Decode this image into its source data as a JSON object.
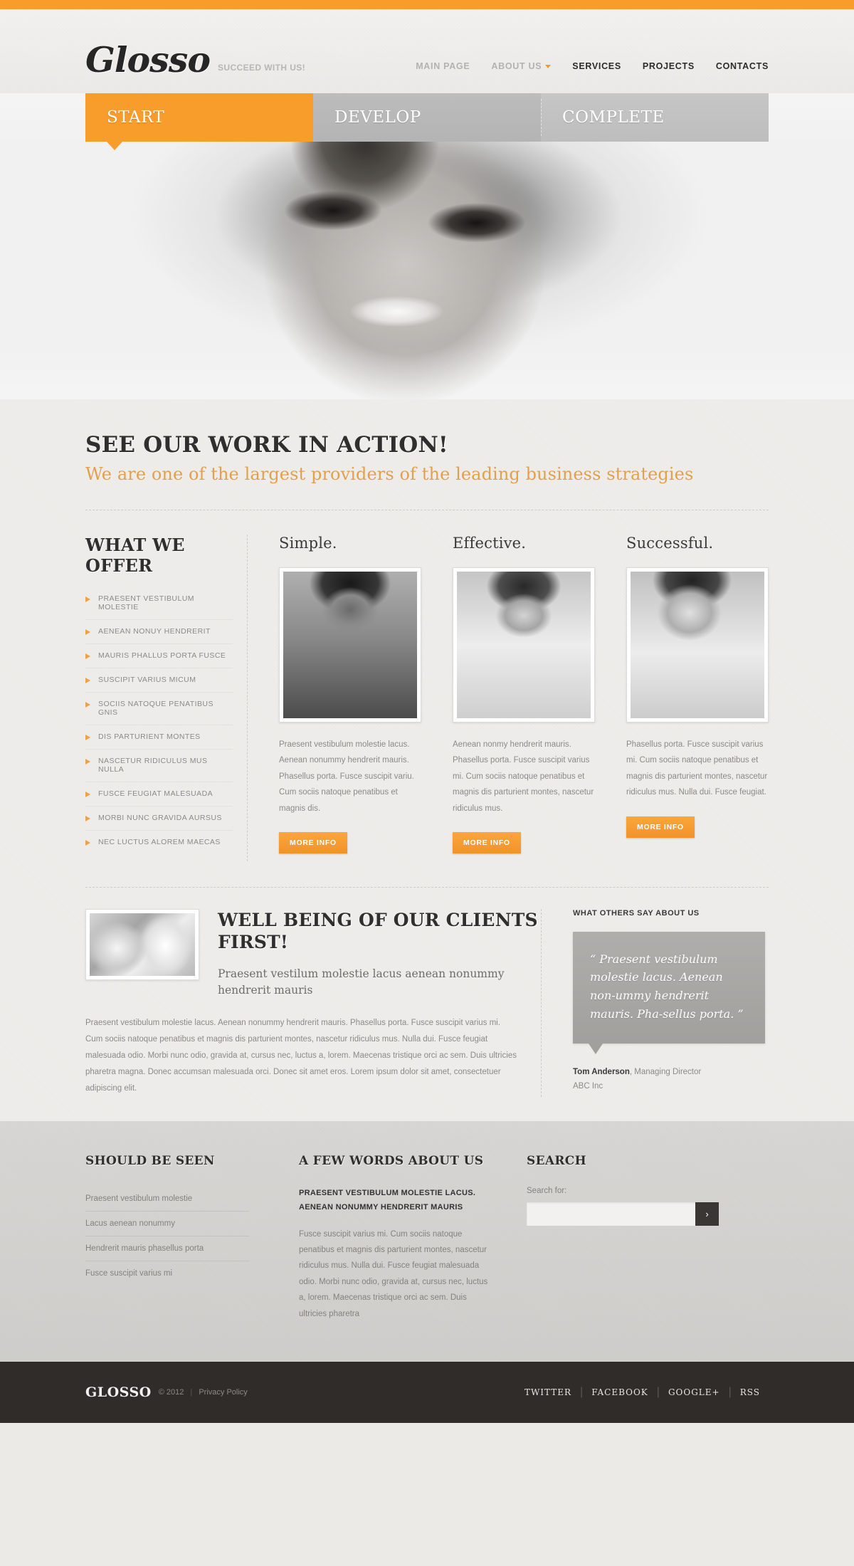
{
  "brand": {
    "logo": "Glosso",
    "tagline": "SUCCEED WITH US!"
  },
  "nav": {
    "items": [
      {
        "label": "MAIN PAGE",
        "state": "dim",
        "caret": false
      },
      {
        "label": "ABOUT US",
        "state": "dim",
        "caret": true
      },
      {
        "label": "SERVICES",
        "state": "active",
        "caret": false
      },
      {
        "label": "PROJECTS",
        "state": "active",
        "caret": false
      },
      {
        "label": "CONTACTS",
        "state": "active",
        "caret": false
      }
    ]
  },
  "tabs": [
    {
      "label": "START",
      "active": true
    },
    {
      "label": "DEVELOP",
      "active": false
    },
    {
      "label": "COMPLETE",
      "active": false
    }
  ],
  "intro": {
    "title": "SEE OUR WORK IN ACTION!",
    "subtitle": "We are one of the largest providers of the leading business strategies"
  },
  "offer": {
    "heading": "WHAT WE OFFER",
    "items": [
      "PRAESENT VESTIBULUM MOLESTIE",
      "AENEAN NONUY HENDRERIT",
      "MAURIS PHALLUS PORTA FUSCE",
      "SUSCIPIT VARIUS MICUM",
      "SOCIIS NATOQUE PENATIBUS GNIS",
      "DIS PARTURIENT MONTES",
      "NASCETUR RIDICULUS MUS NULLA",
      "FUSCE FEUGIAT MALESUADA",
      "MORBI NUNC GRAVIDA AURSUS",
      "NEC LUCTUS ALOREM  MAECAS"
    ]
  },
  "cards": [
    {
      "title": "Simple.",
      "text": "Praesent vestibulum molestie lacus. Aenean nonummy hendrerit mauris. Phasellus porta. Fusce suscipit variu. Cum sociis natoque penatibus et magnis dis.",
      "button": "MORE INFO",
      "image": "portrait-man-dark"
    },
    {
      "title": "Effective.",
      "text": "Aenean nonmy hendrerit mauris. Phasellus porta. Fusce suscipit varius mi. Cum sociis natoque penatibus et magnis dis parturient montes, nascetur ridiculus mus.",
      "button": "MORE INFO",
      "image": "portrait-man-glasses"
    },
    {
      "title": "Successful.",
      "text": "Phasellus porta. Fusce suscipit varius mi. Cum sociis natoque penatibus et magnis dis parturient montes, nascetur ridiculus mus. Nulla dui. Fusce feugiat.",
      "button": "MORE INFO",
      "image": "portrait-woman-phone"
    }
  ],
  "wellbeing": {
    "heading": "WELL BEING OF OUR CLIENTS FIRST!",
    "lead": "Praesent vestilum molestie lacus aenean nonummy hendrerit mauris",
    "body": "Praesent vestibulum molestie lacus. Aenean nonummy hendrerit mauris. Phasellus porta. Fusce suscipit varius mi. Cum sociis natoque penatibus et magnis dis parturient montes, nascetur ridiculus mus. Nulla dui. Fusce feugiat malesuada odio. Morbi nunc odio, gravida at, cursus nec, luctus a, lorem. Maecenas tristique orci ac sem. Duis ultricies pharetra magna. Donec accumsan malesuada orci. Donec sit amet eros. Lorem ipsum dolor sit amet, consectetuer adipiscing elit.",
    "image": "hands-photo"
  },
  "testimonial": {
    "heading": "WHAT OTHERS SAY ABOUT US",
    "quote": "“ Praesent vestibulum molestie lacus. Aenean non-ummy hendrerit mauris. Pha-sellus porta. ”",
    "author": "Tom Anderson",
    "role": ", Managing Director",
    "company": "ABC Inc"
  },
  "footer": {
    "col1": {
      "heading": "SHOULD BE SEEN",
      "links": [
        "Praesent vestibulum molestie",
        "Lacus aenean nonummy",
        "Hendrerit mauris phasellus porta",
        "Fusce suscipit varius mi"
      ]
    },
    "col2": {
      "heading": "A FEW WORDS ABOUT US",
      "bold": "PRAESENT VESTIBULUM MOLESTIE LACUS. AENEAN NONUMMY HENDRERIT MAURIS",
      "text": "Fusce suscipit varius mi. Cum sociis natoque penatibus et magnis dis parturient montes, nascetur ridiculus mus. Nulla dui. Fusce feugiat malesuada odio. Morbi nunc odio, gravida at, cursus nec, luctus a, lorem. Maecenas tristique orci ac sem. Duis ultricies pharetra"
    },
    "col3": {
      "heading": "SEARCH",
      "label": "Search for:",
      "input_value": "",
      "input_placeholder": "",
      "button_icon": "›"
    }
  },
  "bottom": {
    "logo": "GLOSSO",
    "copyright": "© 2012",
    "privacy": "Privacy Policy",
    "social": [
      "TWITTER",
      "FACEBOOK",
      "GOOGLE+",
      "RSS"
    ]
  },
  "colors": {
    "accent": "#f89c2b",
    "dark": "#2f2c2a",
    "page_bg": "#efedea",
    "footer_bg": "#d4d2cf"
  }
}
